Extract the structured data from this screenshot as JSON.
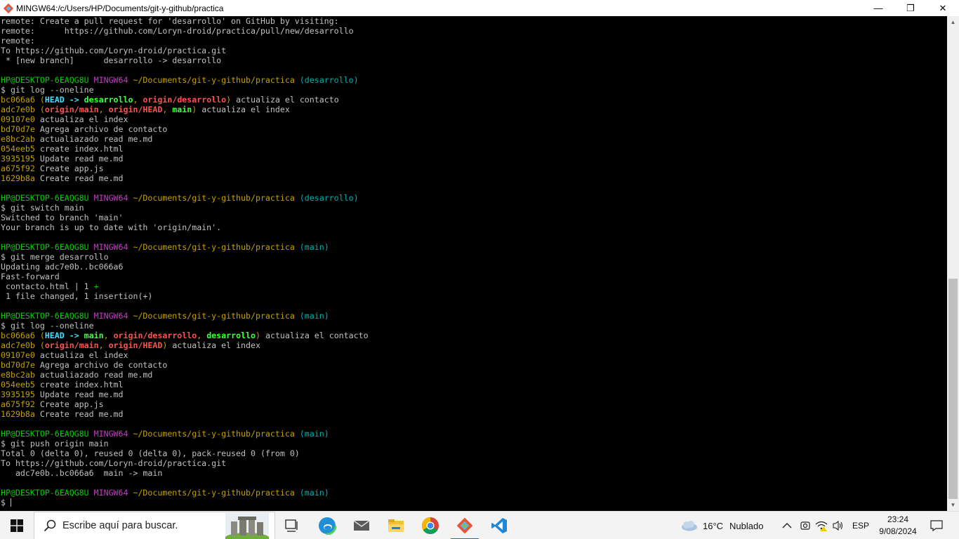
{
  "window": {
    "title": "MINGW64:/c/Users/HP/Documents/git-y-github/practica",
    "minimize_label": "—",
    "maximize_label": "❐",
    "close_label": "✕"
  },
  "terminal": {
    "lines": [
      [
        {
          "t": "remote: Create a pull request for 'desarrollo' on GitHub by visiting:"
        }
      ],
      [
        {
          "t": "remote:      https://github.com/Loryn-droid/practica/pull/new/desarrollo"
        }
      ],
      [
        {
          "t": "remote:"
        }
      ],
      [
        {
          "t": "To https://github.com/Loryn-droid/practica.git"
        }
      ],
      [
        {
          "t": " * [new branch]      desarrollo -> desarrollo"
        }
      ],
      [
        {
          "t": ""
        }
      ],
      [
        {
          "t": "HP@DESKTOP-6EAQG8U ",
          "c": "green"
        },
        {
          "t": "MINGW64 ",
          "c": "mag"
        },
        {
          "t": "~/Documents/git-y-github/practica ",
          "c": "yel"
        },
        {
          "t": "(desarrollo)",
          "c": "cyan"
        }
      ],
      [
        {
          "t": "$ git log --oneline"
        }
      ],
      [
        {
          "t": "bc066a6 ",
          "c": "yel"
        },
        {
          "t": "(",
          "c": "yel"
        },
        {
          "t": "HEAD -> ",
          "c": "bcyan"
        },
        {
          "t": "desarrollo",
          "c": "bgreen"
        },
        {
          "t": ", ",
          "c": "yel"
        },
        {
          "t": "origin/desarrollo",
          "c": "bred"
        },
        {
          "t": ")",
          "c": "yel"
        },
        {
          "t": " actualiza el contacto"
        }
      ],
      [
        {
          "t": "adc7e0b ",
          "c": "yel"
        },
        {
          "t": "(",
          "c": "yel"
        },
        {
          "t": "origin/main",
          "c": "bred"
        },
        {
          "t": ", ",
          "c": "yel"
        },
        {
          "t": "origin/HEAD",
          "c": "bred"
        },
        {
          "t": ", ",
          "c": "yel"
        },
        {
          "t": "main",
          "c": "bgreen"
        },
        {
          "t": ")",
          "c": "yel"
        },
        {
          "t": " actualiza el index"
        }
      ],
      [
        {
          "t": "09107e0 ",
          "c": "yel"
        },
        {
          "t": "actualiza el index"
        }
      ],
      [
        {
          "t": "bd70d7e ",
          "c": "yel"
        },
        {
          "t": "Agrega archivo de contacto"
        }
      ],
      [
        {
          "t": "e8bc2ab ",
          "c": "yel"
        },
        {
          "t": "actualiazado read me.md"
        }
      ],
      [
        {
          "t": "054eeb5 ",
          "c": "yel"
        },
        {
          "t": "create index.html"
        }
      ],
      [
        {
          "t": "3935195 ",
          "c": "yel"
        },
        {
          "t": "Update read me.md"
        }
      ],
      [
        {
          "t": "a675f92 ",
          "c": "yel"
        },
        {
          "t": "Create app.js"
        }
      ],
      [
        {
          "t": "1629b8a ",
          "c": "yel"
        },
        {
          "t": "Create read me.md"
        }
      ],
      [
        {
          "t": ""
        }
      ],
      [
        {
          "t": "HP@DESKTOP-6EAQG8U ",
          "c": "green"
        },
        {
          "t": "MINGW64 ",
          "c": "mag"
        },
        {
          "t": "~/Documents/git-y-github/practica ",
          "c": "yel"
        },
        {
          "t": "(desarrollo)",
          "c": "cyan"
        }
      ],
      [
        {
          "t": "$ git switch main"
        }
      ],
      [
        {
          "t": "Switched to branch 'main'"
        }
      ],
      [
        {
          "t": "Your branch is up to date with 'origin/main'."
        }
      ],
      [
        {
          "t": ""
        }
      ],
      [
        {
          "t": "HP@DESKTOP-6EAQG8U ",
          "c": "green"
        },
        {
          "t": "MINGW64 ",
          "c": "mag"
        },
        {
          "t": "~/Documents/git-y-github/practica ",
          "c": "yel"
        },
        {
          "t": "(main)",
          "c": "cyan"
        }
      ],
      [
        {
          "t": "$ git merge desarrollo"
        }
      ],
      [
        {
          "t": "Updating adc7e0b..bc066a6"
        }
      ],
      [
        {
          "t": "Fast-forward"
        }
      ],
      [
        {
          "t": " contacto.html | 1 "
        },
        {
          "t": "+",
          "c": "plus"
        }
      ],
      [
        {
          "t": " 1 file changed, 1 insertion(+)"
        }
      ],
      [
        {
          "t": ""
        }
      ],
      [
        {
          "t": "HP@DESKTOP-6EAQG8U ",
          "c": "green"
        },
        {
          "t": "MINGW64 ",
          "c": "mag"
        },
        {
          "t": "~/Documents/git-y-github/practica ",
          "c": "yel"
        },
        {
          "t": "(main)",
          "c": "cyan"
        }
      ],
      [
        {
          "t": "$ git log --oneline"
        }
      ],
      [
        {
          "t": "bc066a6 ",
          "c": "yel"
        },
        {
          "t": "(",
          "c": "yel"
        },
        {
          "t": "HEAD -> ",
          "c": "bcyan"
        },
        {
          "t": "main",
          "c": "bgreen"
        },
        {
          "t": ", ",
          "c": "yel"
        },
        {
          "t": "origin/desarrollo",
          "c": "bred"
        },
        {
          "t": ", ",
          "c": "yel"
        },
        {
          "t": "desarrollo",
          "c": "bgreen"
        },
        {
          "t": ")",
          "c": "yel"
        },
        {
          "t": " actualiza el contacto"
        }
      ],
      [
        {
          "t": "adc7e0b ",
          "c": "yel"
        },
        {
          "t": "(",
          "c": "yel"
        },
        {
          "t": "origin/main",
          "c": "bred"
        },
        {
          "t": ", ",
          "c": "yel"
        },
        {
          "t": "origin/HEAD",
          "c": "bred"
        },
        {
          "t": ")",
          "c": "yel"
        },
        {
          "t": " actualiza el index"
        }
      ],
      [
        {
          "t": "09107e0 ",
          "c": "yel"
        },
        {
          "t": "actualiza el index"
        }
      ],
      [
        {
          "t": "bd70d7e ",
          "c": "yel"
        },
        {
          "t": "Agrega archivo de contacto"
        }
      ],
      [
        {
          "t": "e8bc2ab ",
          "c": "yel"
        },
        {
          "t": "actualiazado read me.md"
        }
      ],
      [
        {
          "t": "054eeb5 ",
          "c": "yel"
        },
        {
          "t": "create index.html"
        }
      ],
      [
        {
          "t": "3935195 ",
          "c": "yel"
        },
        {
          "t": "Update read me.md"
        }
      ],
      [
        {
          "t": "a675f92 ",
          "c": "yel"
        },
        {
          "t": "Create app.js"
        }
      ],
      [
        {
          "t": "1629b8a ",
          "c": "yel"
        },
        {
          "t": "Create read me.md"
        }
      ],
      [
        {
          "t": ""
        }
      ],
      [
        {
          "t": "HP@DESKTOP-6EAQG8U ",
          "c": "green"
        },
        {
          "t": "MINGW64 ",
          "c": "mag"
        },
        {
          "t": "~/Documents/git-y-github/practica ",
          "c": "yel"
        },
        {
          "t": "(main)",
          "c": "cyan"
        }
      ],
      [
        {
          "t": "$ git push origin main"
        }
      ],
      [
        {
          "t": "Total 0 (delta 0), reused 0 (delta 0), pack-reused 0 (from 0)"
        }
      ],
      [
        {
          "t": "To https://github.com/Loryn-droid/practica.git"
        }
      ],
      [
        {
          "t": "   adc7e0b..bc066a6  main -> main"
        }
      ],
      [
        {
          "t": ""
        }
      ],
      [
        {
          "t": "HP@DESKTOP-6EAQG8U ",
          "c": "green"
        },
        {
          "t": "MINGW64 ",
          "c": "mag"
        },
        {
          "t": "~/Documents/git-y-github/practica ",
          "c": "yel"
        },
        {
          "t": "(main)",
          "c": "cyan"
        }
      ],
      [
        {
          "t": "$ "
        },
        {
          "cursor": true
        }
      ]
    ]
  },
  "taskbar": {
    "search_placeholder": "Escribe aquí para buscar.",
    "apps": [
      "task-view",
      "edge",
      "mail",
      "file-explorer",
      "chrome",
      "git-bash",
      "vscode"
    ],
    "weather_temp": "16°C",
    "weather_desc": "Nublado",
    "language": "ESP",
    "time": "23:24",
    "date": "9/08/2024"
  },
  "colors": {
    "terminal_bg": "#000000",
    "prompt_user": "#00d000",
    "prompt_mingw": "#bf40bf",
    "prompt_path": "#c0a000",
    "prompt_branch": "#00b0b0"
  }
}
